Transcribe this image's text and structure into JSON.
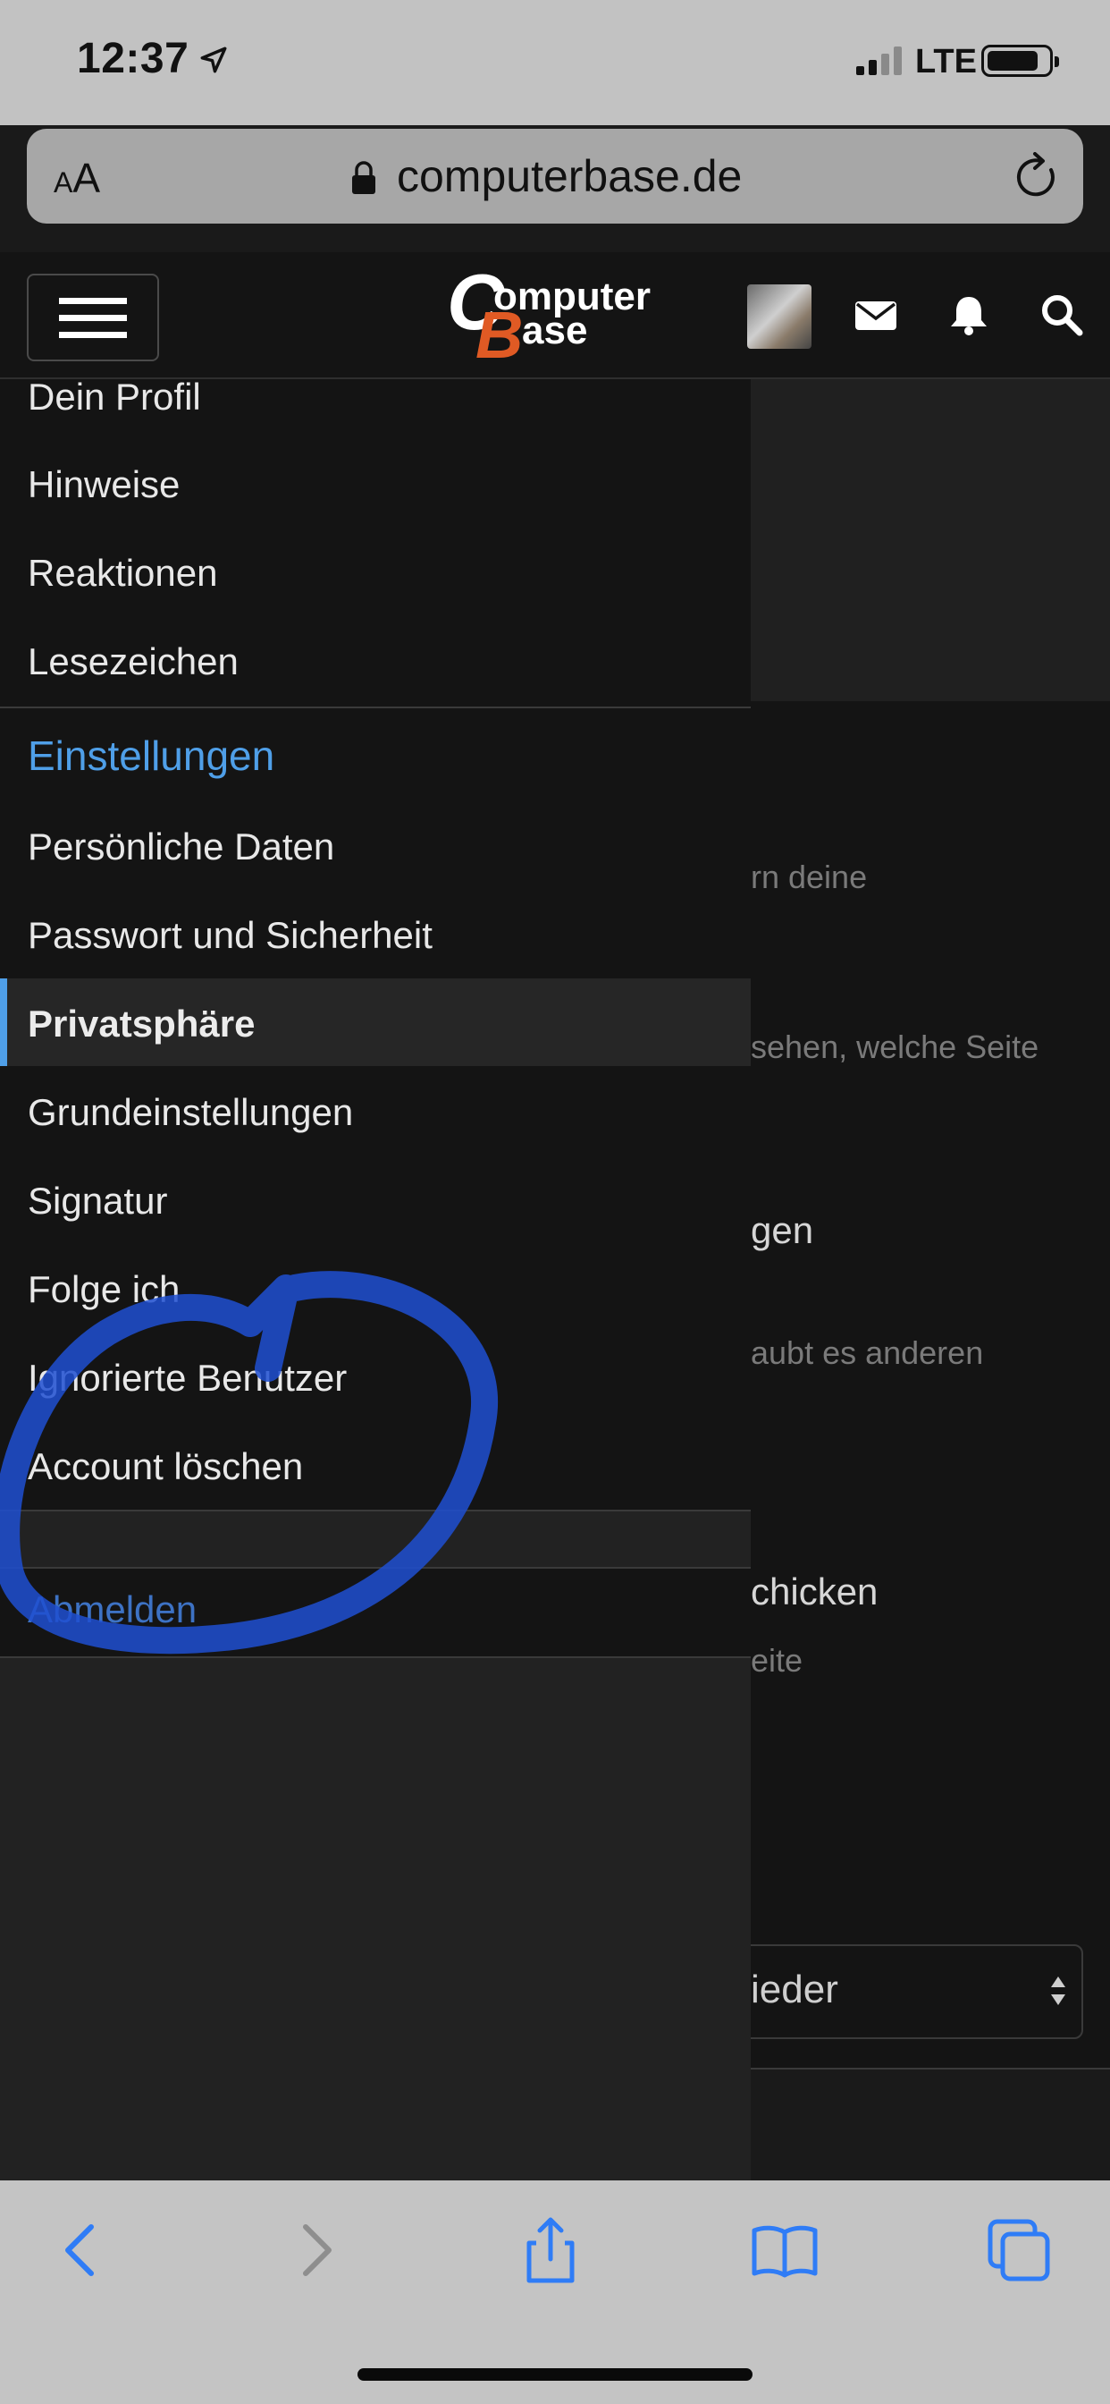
{
  "status_bar": {
    "time": "12:37",
    "network": "LTE"
  },
  "address_bar": {
    "text_size_label": "AA",
    "url": "computerbase.de"
  },
  "header": {
    "logo": "ComputerBase"
  },
  "menu": {
    "items_top": [
      "Dein Profil",
      "Hinweise",
      "Reaktionen",
      "Lesezeichen"
    ],
    "settings_heading": "Einstellungen",
    "items_settings": [
      "Persönliche Daten",
      "Passwort und Sicherheit",
      "Privatsphäre",
      "Grundeinstellungen",
      "Signatur",
      "Folge ich",
      "Ignorierte Benutzer",
      "Account löschen"
    ],
    "active_item": "Privatsphäre",
    "logout": "Abmelden"
  },
  "background_page": {
    "fragments": [
      "rn deine",
      "sehen, welche Seite",
      "gen",
      "aubt es anderen",
      "chicken",
      "eite"
    ],
    "select_value": "ieder"
  },
  "annotation": {
    "shape": "hand-drawn circle",
    "color": "#1f4fd1",
    "target": "Account löschen"
  },
  "colors": {
    "accent": "#4f9fe8",
    "menu_bg": "#141414",
    "toolbar_icon": "#2f7cf6"
  }
}
